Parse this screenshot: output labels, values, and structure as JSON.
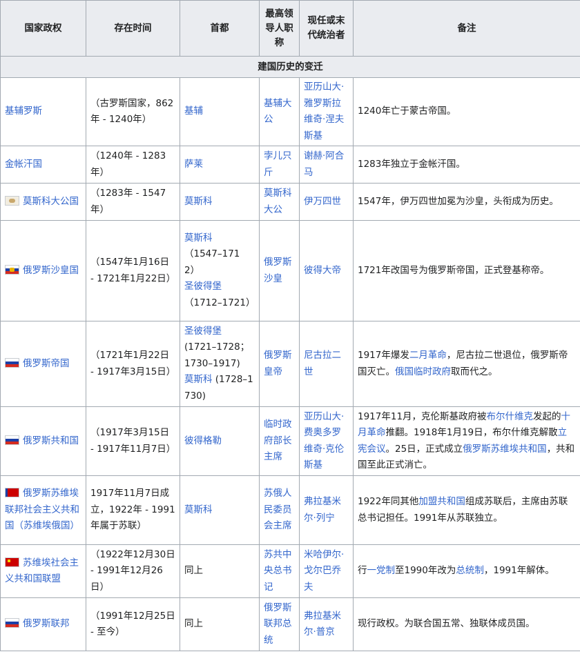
{
  "headers": {
    "state": "国家政权",
    "period": "存在时间",
    "capital": "首都",
    "title": "最高领导人职称",
    "ruler": "现任或末代统治者",
    "note": "备注"
  },
  "section_title": "建国历史的变迁",
  "rows": [
    {
      "state": "基辅罗斯",
      "period": "（古罗斯国家，862年 - 1240年）",
      "capital": "基辅",
      "title": "基辅大公",
      "ruler": "亚历山大·雅罗斯拉维奇·涅夫斯基",
      "note": "1240年亡于蒙古帝国。"
    },
    {
      "state": "金帐汗国",
      "period": "（1240年 - 1283年）",
      "capital": "萨莱",
      "title": "孛儿只斤",
      "ruler": "谢赫·阿合马",
      "note": "1283年独立于金帐汗国。"
    },
    {
      "state": "莫斯科大公国",
      "period": "（1283年 - 1547年）",
      "capital": "莫斯科",
      "title": "莫斯科大公",
      "ruler": "伊万四世",
      "note": "1547年，伊万四世加冕为沙皇，头衔成为历史。"
    },
    {
      "state": "俄罗斯沙皇国",
      "period": "（1547年1月16日 - 1721年1月22日）",
      "capital_a": "莫斯科",
      "capital_a_years": "（1547–1712）",
      "capital_b": "圣彼得堡",
      "capital_b_years": "（1712–1721）",
      "title": "俄罗斯沙皇",
      "ruler": "彼得大帝",
      "note": "1721年改国号为俄罗斯帝国，正式登基称帝。"
    },
    {
      "state": "俄罗斯帝国",
      "period": "（1721年1月22日 - 1917年3月15日）",
      "capital_a": "圣彼得堡",
      "capital_a_years": "(1721–1728；1730–1917)",
      "capital_b": "莫斯科",
      "capital_b_years": " (1728–1730)",
      "title": "俄罗斯皇帝",
      "ruler": "尼古拉二世",
      "note_1": "1917年爆发",
      "note_link_1": "二月革命",
      "note_2": "，尼古拉二世退位，俄罗斯帝国灭亡。",
      "note_link_2": "俄国临时政府",
      "note_3": "取而代之。"
    },
    {
      "state": "俄罗斯共和国",
      "period": "（1917年3月15日 - 1917年11月7日）",
      "capital": "彼得格勒",
      "title": "临时政府部长主席",
      "ruler": "亚历山大·费奥多罗维奇·克伦斯基",
      "note_1": "1917年11月，克伦斯基政府被",
      "note_link_1": "布尔什维克",
      "note_2": "发起的",
      "note_link_2": "十月革命",
      "note_3": "推翻。1918年1月19日，布尔什维克解散",
      "note_link_3": "立宪会议",
      "note_4": "。25日，正式成立",
      "note_link_4": "俄罗斯苏维埃共和国",
      "note_5": "，共和国至此正式消亡。"
    },
    {
      "state": "俄罗斯苏维埃联邦社会主义共和国（苏维埃俄国）",
      "period": "1917年11月7日成立，1922年 - 1991年属于苏联）",
      "capital": "莫斯科",
      "title": "苏俄人民委员会主席",
      "ruler": "弗拉基米尔·列宁",
      "note_1": "1922年同其他",
      "note_link_1": "加盟共和国",
      "note_2": "组成苏联后，主席由苏联总书记担任。1991年从苏联独立。"
    },
    {
      "state": "苏维埃社会主义共和国联盟",
      "period": "（1922年12月30日 - 1991年12月26日）",
      "capital": "同上",
      "title": "苏共中央总书记",
      "ruler": "米哈伊尔·戈尔巴乔夫",
      "note_1": "行",
      "note_link_1": "一党制",
      "note_2": "至1990年改为",
      "note_link_2": "总统制",
      "note_3": "，1991年解体。"
    },
    {
      "state": "俄罗斯联邦",
      "period": "（1991年12月25日 - 至今）",
      "capital": "同上",
      "title": "俄罗斯联邦总统",
      "ruler": "弗拉基米尔·普京",
      "note": "现行政权。为联合国五常、独联体成员国。"
    }
  ]
}
